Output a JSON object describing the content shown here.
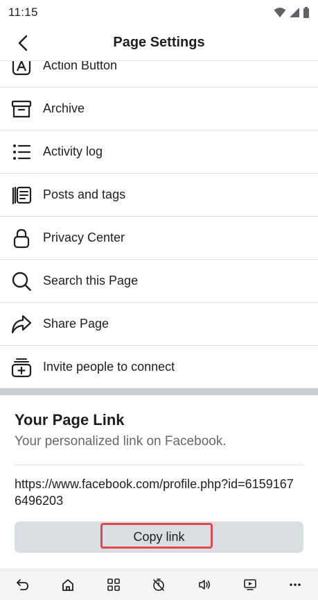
{
  "status_bar": {
    "time": "11:15"
  },
  "header": {
    "title": "Page Settings"
  },
  "menu": {
    "items": [
      {
        "label": "Action Button",
        "icon": "action-button-icon"
      },
      {
        "label": "Archive",
        "icon": "archive-icon"
      },
      {
        "label": "Activity log",
        "icon": "list-icon"
      },
      {
        "label": "Posts and tags",
        "icon": "posts-tags-icon"
      },
      {
        "label": "Privacy Center",
        "icon": "lock-icon"
      },
      {
        "label": "Search this Page",
        "icon": "search-icon"
      },
      {
        "label": "Share Page",
        "icon": "share-icon"
      },
      {
        "label": "Invite people to connect",
        "icon": "invite-icon"
      }
    ]
  },
  "page_link": {
    "title": "Your Page Link",
    "subtitle": "Your personalized link on Facebook.",
    "url": "https://www.facebook.com/profile.php?id=61591676496203",
    "copy_label": "Copy link"
  },
  "colors": {
    "highlight": "#e0474c",
    "button_bg": "#dadde1",
    "section_band": "#c9ccd1"
  }
}
